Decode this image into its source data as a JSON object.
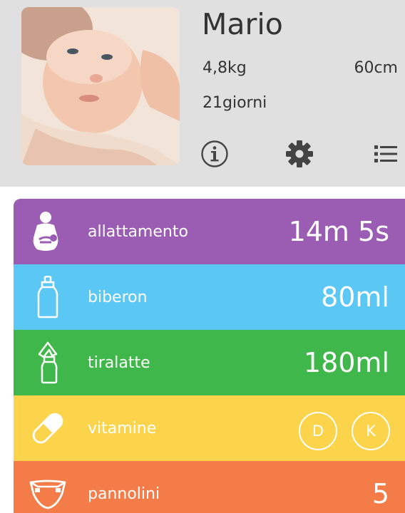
{
  "profile": {
    "name": "Mario",
    "weight": "4,8kg",
    "height": "60cm",
    "age": "21giorni",
    "photo": "baby-photo",
    "actions": [
      "info-icon",
      "gear-icon",
      "list-icon"
    ]
  },
  "activities": [
    {
      "label": "allattamento",
      "value": "14m 5s",
      "color": "#9b5cb4",
      "icon": "breastfeeding-icon"
    },
    {
      "label": "biberon",
      "value": "80ml",
      "color": "#5bc7f4",
      "icon": "baby-bottle-icon"
    },
    {
      "label": "tiralatte",
      "value": "180ml",
      "color": "#3fb74a",
      "icon": "breast-pump-icon"
    },
    {
      "label": "vitamine",
      "color": "#fbd44c",
      "icon": "pill-icon",
      "buttons": [
        "D",
        "K"
      ]
    },
    {
      "label": "pannolini",
      "value": "5",
      "color": "#f47c48",
      "icon": "diaper-icon"
    }
  ]
}
